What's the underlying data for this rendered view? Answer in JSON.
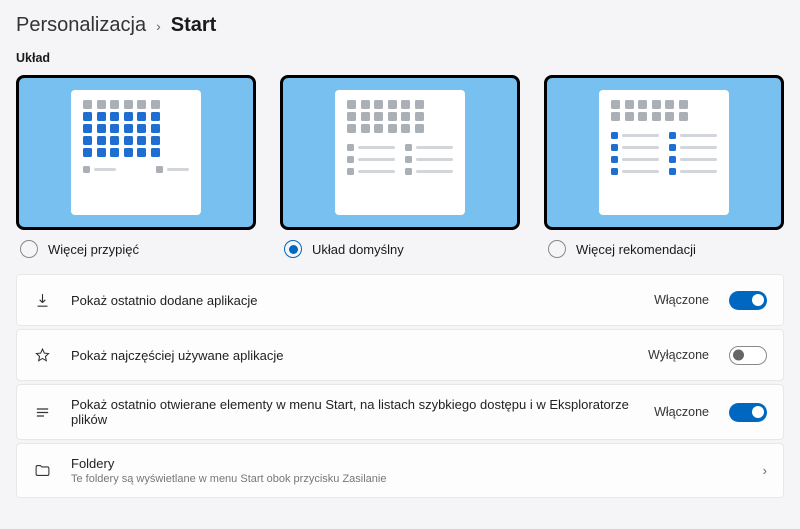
{
  "breadcrumb": {
    "parent": "Personalizacja",
    "current": "Start"
  },
  "section_label": "Układ",
  "layouts": [
    {
      "label": "Więcej przypięć",
      "selected": false
    },
    {
      "label": "Układ domyślny",
      "selected": true
    },
    {
      "label": "Więcej rekomendacji",
      "selected": false
    }
  ],
  "settings": {
    "recent_apps": {
      "label": "Pokaż ostatnio dodane aplikacje",
      "state": "Włączone",
      "on": true
    },
    "most_used": {
      "label": "Pokaż najczęściej używane aplikacje",
      "state": "Wyłączone",
      "on": false
    },
    "recent_items": {
      "label": "Pokaż ostatnio otwierane elementy w menu Start, na listach szybkiego dostępu i w Eksploratorze plików",
      "state": "Włączone",
      "on": true
    },
    "folders": {
      "title": "Foldery",
      "subtitle": "Te foldery są wyświetlane w menu Start obok przycisku Zasilanie"
    }
  }
}
